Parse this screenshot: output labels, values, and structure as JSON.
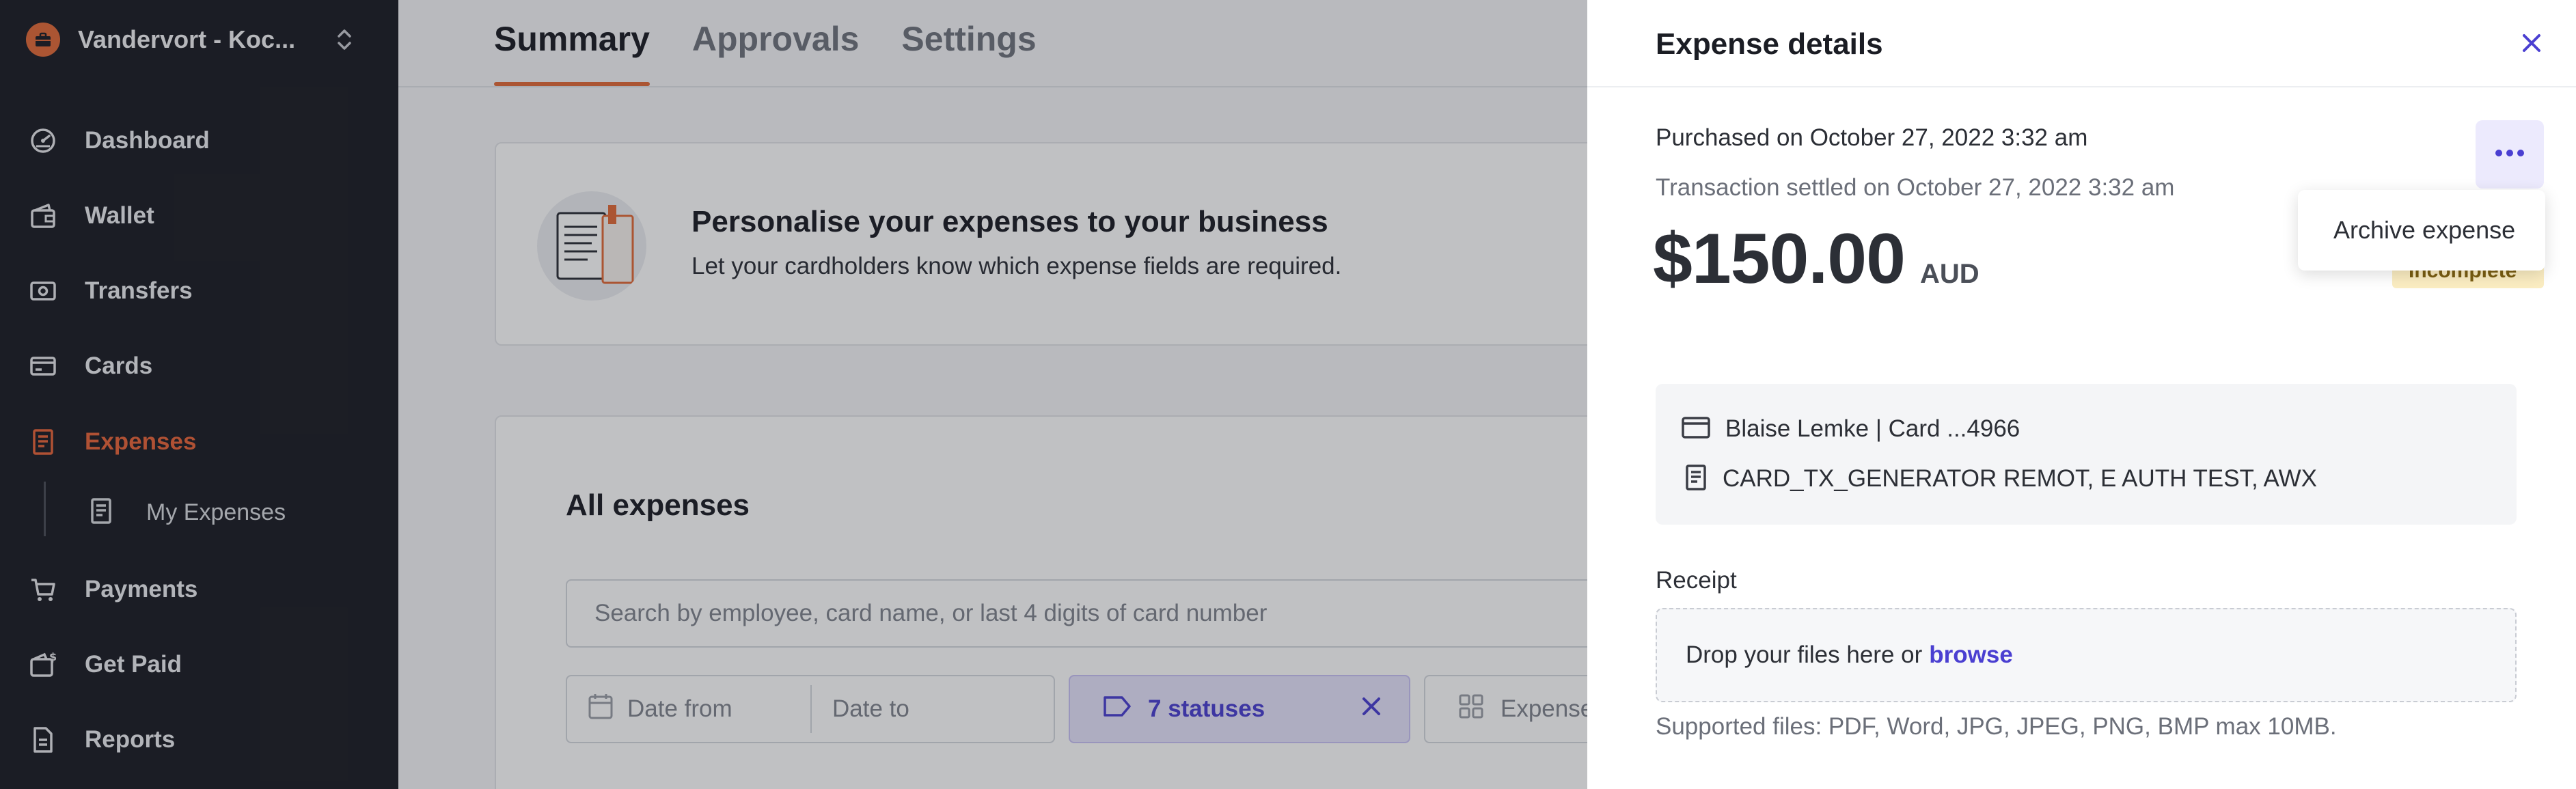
{
  "sidebar": {
    "org_name": "Vandervort - Koc...",
    "items": [
      {
        "label": "Dashboard",
        "icon": "dashboard-icon"
      },
      {
        "label": "Wallet",
        "icon": "wallet-icon"
      },
      {
        "label": "Transfers",
        "icon": "transfers-icon"
      },
      {
        "label": "Cards",
        "icon": "card-icon"
      },
      {
        "label": "Expenses",
        "icon": "expenses-icon",
        "active": true
      },
      {
        "label": "Payments",
        "icon": "cart-icon"
      },
      {
        "label": "Get Paid",
        "icon": "get-paid-icon"
      },
      {
        "label": "Reports",
        "icon": "report-icon"
      }
    ],
    "sub_items": [
      {
        "label": "My Expenses",
        "icon": "receipt-icon"
      }
    ]
  },
  "main": {
    "tabs": [
      {
        "label": "Summary",
        "active": true
      },
      {
        "label": "Approvals"
      },
      {
        "label": "Settings"
      }
    ],
    "banner": {
      "title": "Personalise your expenses to your business",
      "text": "Let your cardholders know which expense fields are required."
    },
    "all_expenses": {
      "title": "All expenses",
      "search_placeholder": "Search by employee, card name, or last 4 digits of card number",
      "date_from": "Date from",
      "date_to": "Date to",
      "status_filter": "7 statuses",
      "type_filter": "Expense"
    }
  },
  "drawer": {
    "title": "Expense details",
    "purchased": "Purchased on October 27, 2022 3:32 am",
    "settled": "Transaction settled on October 27, 2022 3:32 am",
    "amount": "$150.00",
    "currency": "AUD",
    "status_badge": "Incomplete",
    "menu_item": "Archive expense",
    "card": "Blaise Lemke | Card ...4966",
    "merchant": "CARD_TX_GENERATOR REMOT, E AUTH TEST, AWX",
    "receipt_label": "Receipt",
    "drop_text": "Drop your files here or",
    "browse": "browse",
    "supported": "Supported files: PDF, Word, JPG, JPEG, PNG, BMP max 10MB."
  },
  "colors": {
    "accent": "#e26a38",
    "primary": "#4a3fd1",
    "sidebar_bg": "#1b1d24",
    "badge_bg": "#fbedc2"
  }
}
